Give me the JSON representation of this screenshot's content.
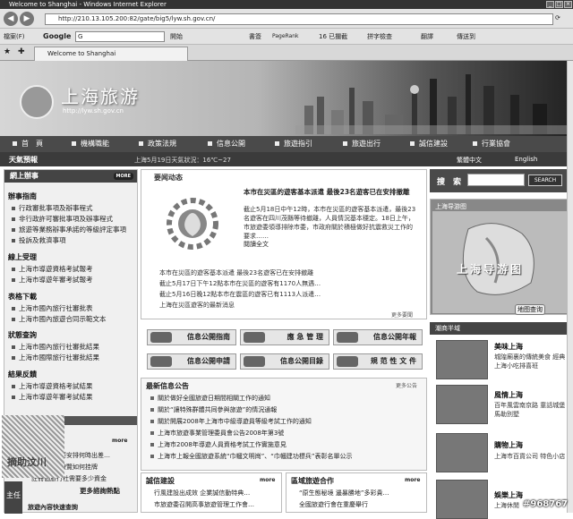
{
  "browser": {
    "window_title": "Welcome to Shanghai - Windows Internet Explorer",
    "url": "http://210.13.105.200:82/gate/big5/lyw.sh.gov.cn/",
    "tab_title": "Welcome to Shanghai",
    "toolbar": {
      "label": "檔案(F)",
      "google": "Google",
      "search_value": "G",
      "start": "開始",
      "bookmarks": "書簽",
      "pagerank": "PageRank",
      "blocked": "16 已攔截",
      "spellcheck": "拼字檢查",
      "translate": "翻譯",
      "send_to": "傳送到"
    }
  },
  "site": {
    "logo_title": "上海旅游",
    "logo_url": "http://lyw.sh.gov.cn",
    "nav": [
      "首　頁",
      "機構職能",
      "政策法規",
      "信息公開",
      "旅遊指引",
      "旅遊出行",
      "誠信建設",
      "行業協會"
    ],
    "weather_title": "天氣預報",
    "weather_text": "上海5月19日天氣狀況：16℃~27",
    "lang_trad": "繁體中文",
    "lang_en": "English"
  },
  "left": {
    "online_head": "網上辦事",
    "more": "MORE",
    "sections": [
      {
        "title": "辦事指南",
        "links": [
          "行政審批事項及辦事程式",
          "非行政許可審批事項及辦事程式",
          "旅遊等業務辦事承諾的等級評定事項",
          "投訴及救濟事項"
        ]
      },
      {
        "title": "線上受理",
        "links": [
          "上海市導遊資格考試報考",
          "上海市導遊年審考試報考"
        ]
      },
      {
        "title": "表格下載",
        "links": [
          "上海市國內旅行社審批表",
          "上海市國內旅遊合同示範文本"
        ]
      },
      {
        "title": "狀態查詢",
        "links": [
          "上海市國內旅行社審批結果",
          "上海市國際旅行社審批結果"
        ]
      },
      {
        "title": "結果反饋",
        "links": [
          "上海市導遊資格考試結果",
          "上海市導遊年審考試結果"
        ]
      }
    ],
    "interact_more": "more",
    "interact_lines": [
      "要安排何時出差…",
      "遊覽如何挂牌",
      "註冊個旅行社需要多少資金"
    ],
    "hot_qa": "更多諮詢熱點",
    "bottom_label": "旅遊內容快速查詢",
    "side_label": "主任"
  },
  "news": {
    "title": "要闻动态",
    "headline": "本市在災區的遊客基本派遣 最後23名遊客已在安排撤離",
    "summary": "截止5月18日中午12時，本市在災區的遊客基本派遣，最後23名遊客在四川茂縣等待撤離，人員情況基本穩定。18日上午，市旅遊委領導排除市委，市政府關於積極做好抗震救災工作的要求……",
    "read_all": "閱讀全文",
    "lines": [
      "本市在災區的遊客基本派遣 最後23名遊客已在安排撤離",
      "截止5月17日下午12點本市在災區的遊客有1170人無遇…",
      "截止5月16日晚12點本市在震區的遊客已有1113人派遣…",
      "上海在災區遊客的最新消息"
    ],
    "more": "更多要聞"
  },
  "info_buttons": [
    "信息公開指南",
    "應 急 管 理",
    "信息公開年報",
    "信息公開申請",
    "信息公開目錄",
    "規 范 性 文 件"
  ],
  "notice": {
    "title": "最新信息公告",
    "more": "更多公告",
    "lines": [
      "關於做好全國旅遊日期間相關工作的通知",
      "關於“讓特殊群體共同參與旅遊”的情況通報",
      "關於開展2008年上海市中級導遊員等級考試工作的通知",
      "上海市旅遊事業管理委員會公告2008年第3號",
      "上海市2008年導遊人員資格考試工作實施意見",
      "上海市上報全國旅遊系統“巾幗文明崗”、“巾幗建功標兵”表彰名單公示"
    ]
  },
  "bottom": {
    "integrity_title": "誠信建設",
    "integrity_more": "more",
    "integrity_lines": [
      "行風建設出成效 企業誠信動特典…",
      "市旅遊委召開高事旅遊管理工作會…"
    ],
    "coop_title": "區域旅遊合作",
    "coop_more": "more",
    "coop_lines": [
      "“原生態秘境 邊暴勝地”多彩貴…",
      "全國旅遊行會在重慶舉行"
    ]
  },
  "right": {
    "search_label": "搜　索",
    "search_btn": "SEARCH",
    "map_title": "上海导游图",
    "map_img_text": "上海导游图",
    "map_query": "地图查询",
    "shop_head": "潮商半域",
    "shops": [
      {
        "title": "美味上海",
        "desc": "城隍廟裏的傳統美食 經典上海小吃排喜班"
      },
      {
        "title": "風情上海",
        "desc": "百年風雲南京路 童話城堡馬勒別墅"
      },
      {
        "title": "購物上海",
        "desc": "上海市百貨公司 特色小店"
      },
      {
        "title": "娛樂上海",
        "desc": "上海休閒"
      }
    ]
  },
  "watermark": "#968767",
  "stamp_text": "摘助汶川",
  "colors": {
    "nav_bg": "#4a4a4a",
    "head_bg": "#444444"
  }
}
